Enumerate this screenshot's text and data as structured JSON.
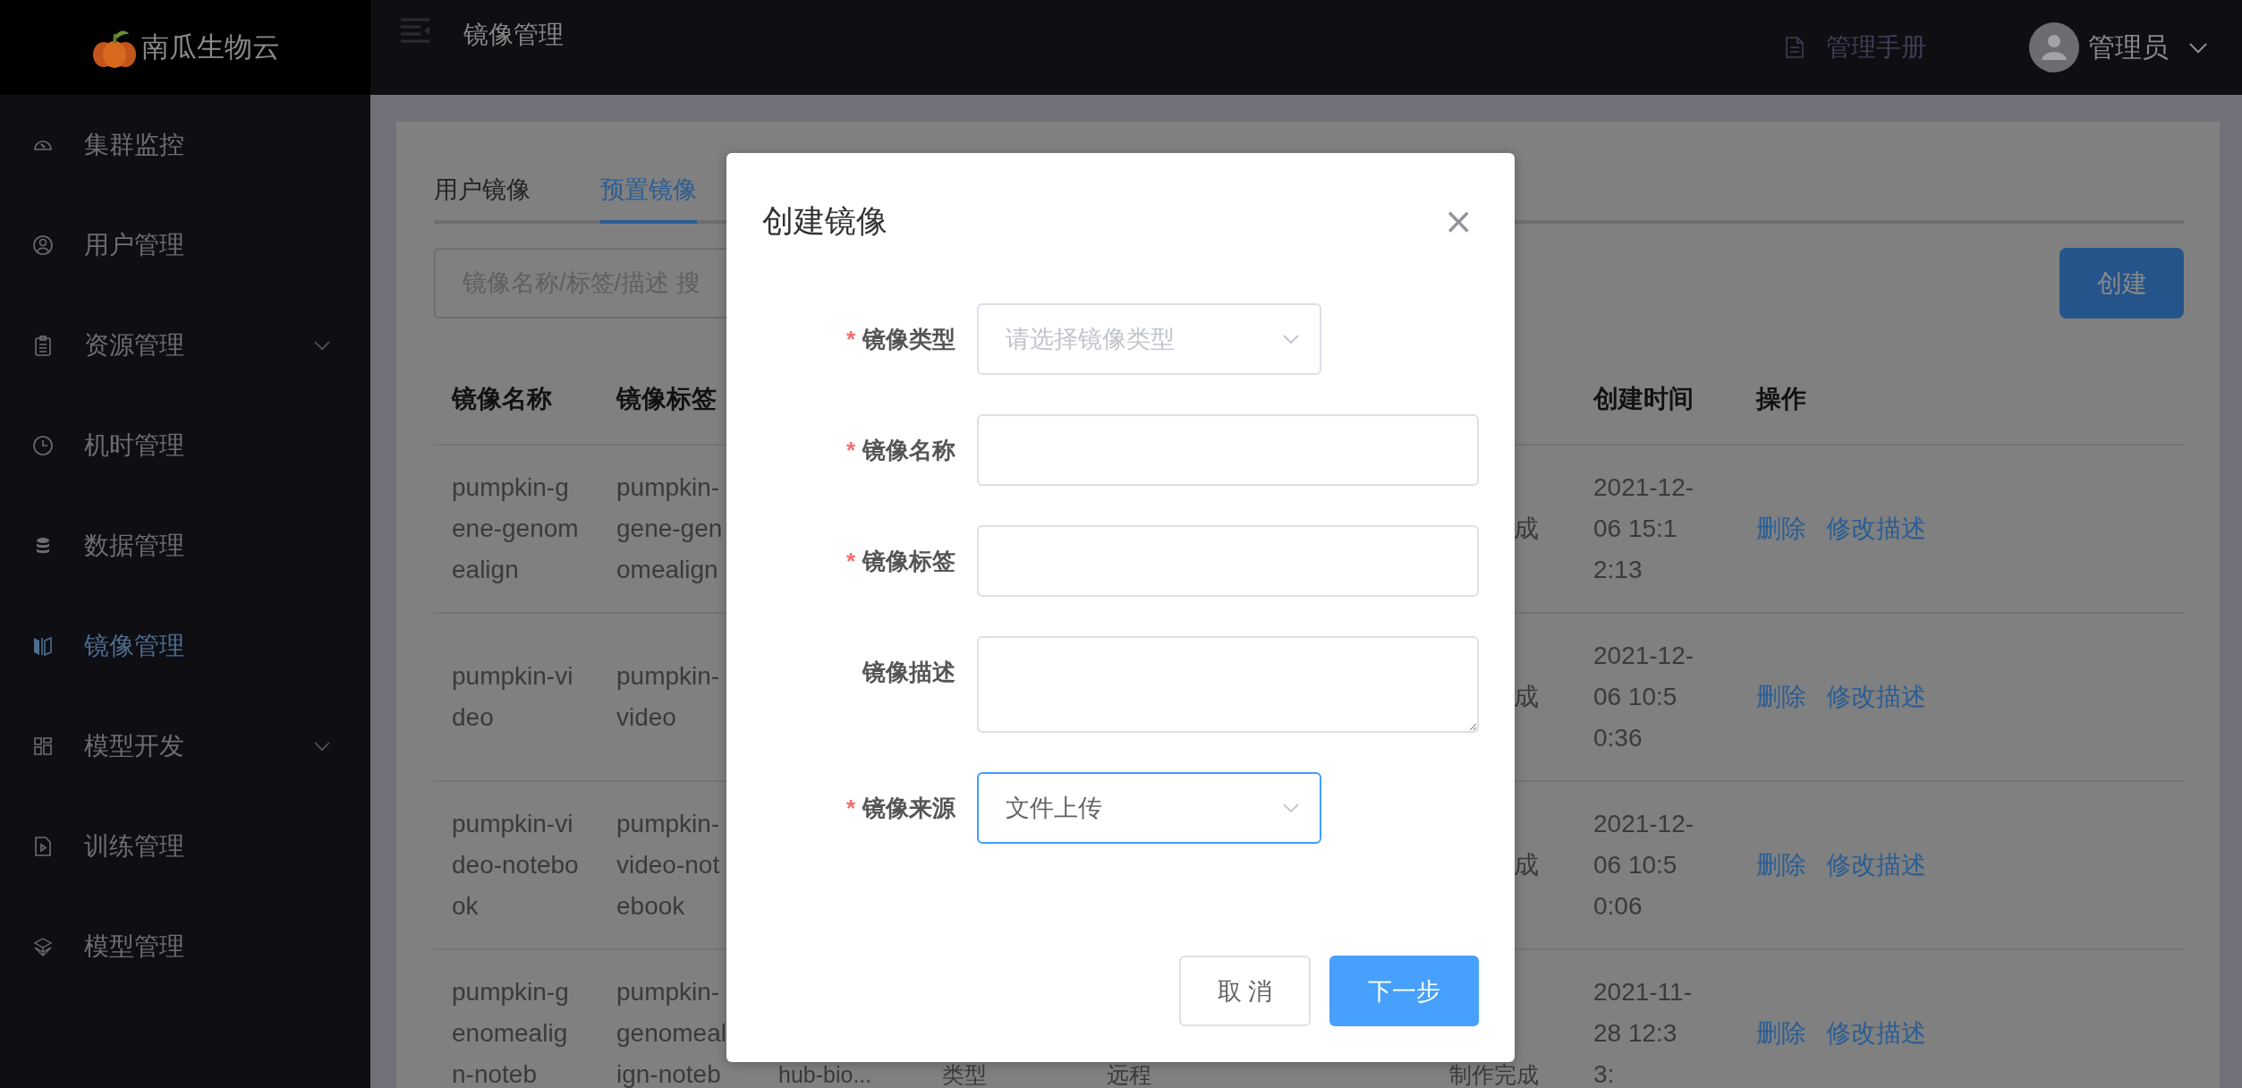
{
  "sidebar": {
    "logo": "南瓜生物云",
    "items": [
      {
        "label": "集群监控",
        "selected": false,
        "has_submenu": false
      },
      {
        "label": "用户管理",
        "selected": false,
        "has_submenu": false
      },
      {
        "label": "资源管理",
        "selected": false,
        "has_submenu": true
      },
      {
        "label": "机时管理",
        "selected": false,
        "has_submenu": false
      },
      {
        "label": "数据管理",
        "selected": false,
        "has_submenu": false
      },
      {
        "label": "镜像管理",
        "selected": true,
        "has_submenu": false
      },
      {
        "label": "模型开发",
        "selected": false,
        "has_submenu": true
      },
      {
        "label": "训练管理",
        "selected": false,
        "has_submenu": false
      },
      {
        "label": "模型管理",
        "selected": false,
        "has_submenu": false
      }
    ]
  },
  "header": {
    "title": "镜像管理",
    "manual": "管理手册",
    "user": "管理员"
  },
  "tabs": [
    {
      "label": "用户镜像",
      "selected": false
    },
    {
      "label": "预置镜像",
      "selected": true
    }
  ],
  "search": {
    "placeholder": "镜像名称/标签/描述 搜"
  },
  "create_button": "创建",
  "table": {
    "headers": {
      "name": "镜像名称",
      "tag": "镜像标签",
      "created": "创建时间",
      "actions": "操作"
    },
    "rows": [
      {
        "name": "pumpkin-gene-genomealign",
        "tag": "pumpkin-gene-genomealign",
        "status": "成",
        "created": "2021-12-06 15:12:13",
        "actions": [
          "删除",
          "修改描述"
        ]
      },
      {
        "name": "pumpkin-video",
        "tag": "pumpkin-video",
        "status": "成",
        "created": "2021-12-06 10:50:36",
        "actions": [
          "删除",
          "修改描述"
        ]
      },
      {
        "name": "pumpkin-video-notebook",
        "tag": "pumpkin-video-notebook",
        "status": "成",
        "created": "2021-12-06 10:50:06",
        "actions": [
          "删除",
          "修改描述"
        ]
      },
      {
        "name": "pumpkin-genomealign-noteb",
        "tag": "pumpkin-genomealign-noteb",
        "column_3": "hub-bio...",
        "column_4": "类型",
        "column_5": "远程",
        "status": "制作完成",
        "created": "2021-11-28 12:33:",
        "actions": [
          "删除",
          "修改描述"
        ]
      }
    ]
  },
  "dialog": {
    "title": "创建镜像",
    "close": "×",
    "fields": [
      {
        "label": "镜像类型",
        "required_mark": "*",
        "kind": "select",
        "placeholder": "请选择镜像类型",
        "focused": false
      },
      {
        "label": "镜像名称",
        "required_mark": "*",
        "kind": "input",
        "focused": false
      },
      {
        "label": "镜像标签",
        "required_mark": "*",
        "kind": "input",
        "focused": false
      },
      {
        "label": "镜像描述",
        "kind": "textarea",
        "focused": false
      },
      {
        "label": "镜像来源",
        "required_mark": "*",
        "kind": "select",
        "value": "文件上传",
        "focused": true
      }
    ],
    "buttons": [
      {
        "label": "取 消",
        "kind": "secondary"
      },
      {
        "label": "下一步",
        "kind": "primary"
      }
    ]
  }
}
